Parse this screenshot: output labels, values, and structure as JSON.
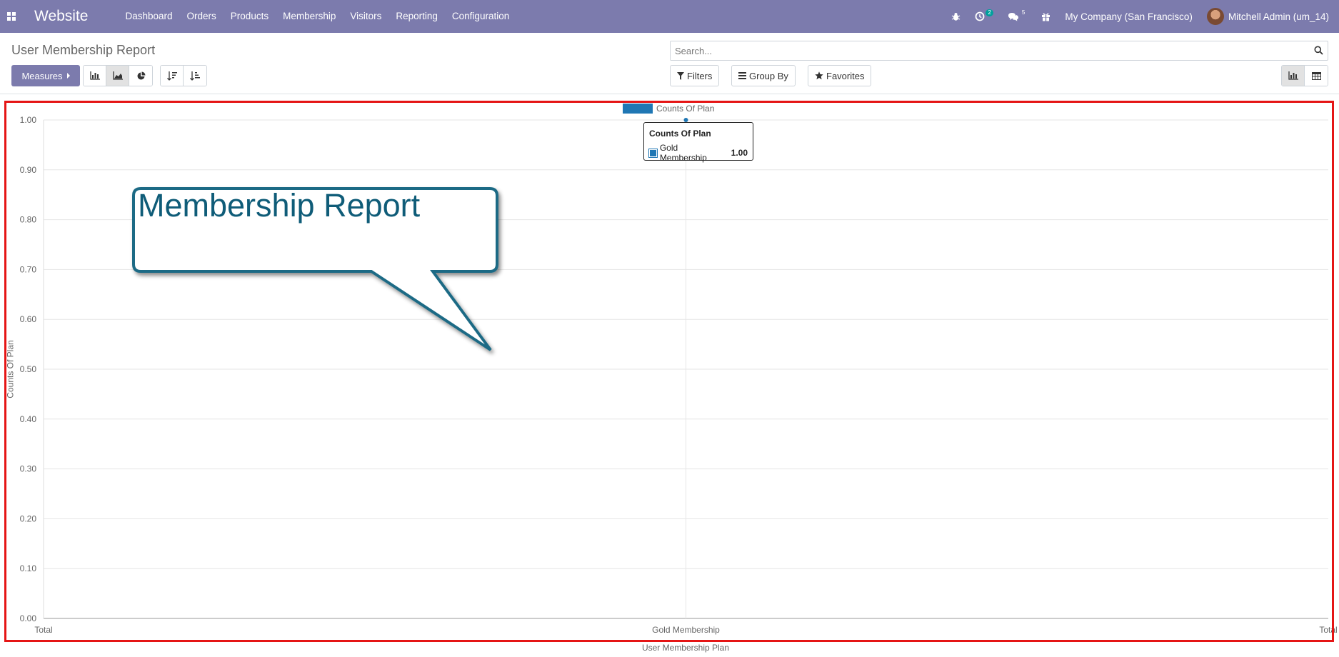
{
  "navbar": {
    "brand": "Website",
    "menu": [
      "Dashboard",
      "Orders",
      "Products",
      "Membership",
      "Visitors",
      "Reporting",
      "Configuration"
    ],
    "activity_count": "2",
    "messages_count": "5",
    "company": "My Company (San Francisco)",
    "user": "Mitchell Admin (um_14)"
  },
  "control": {
    "title": "User Membership Report",
    "measures_label": "Measures",
    "search_placeholder": "Search...",
    "filters_label": "Filters",
    "groupby_label": "Group By",
    "favorites_label": "Favorites"
  },
  "callout": {
    "text": "Membership Report"
  },
  "tooltip": {
    "title": "Counts Of Plan",
    "label": "Gold Membership",
    "value": "1.00"
  },
  "colors": {
    "accent": "#7c7bad",
    "series": "#1f77b4",
    "callout": "#0f5c78",
    "highlight": "#e51515"
  },
  "chart_data": {
    "type": "line",
    "categories": [
      "Total",
      "Gold Membership",
      "Total"
    ],
    "series": [
      {
        "name": "Counts Of Plan",
        "values": [
          null,
          1.0,
          null
        ]
      }
    ],
    "yticks": [
      "1.00",
      "0.90",
      "0.80",
      "0.70",
      "0.60",
      "0.50",
      "0.40",
      "0.30",
      "0.20",
      "0.10",
      "0.00"
    ],
    "xlabel": "User Membership Plan",
    "ylabel": "Counts Of Plan",
    "ylim": [
      0,
      1
    ],
    "grid": true,
    "legend": "top-center"
  }
}
